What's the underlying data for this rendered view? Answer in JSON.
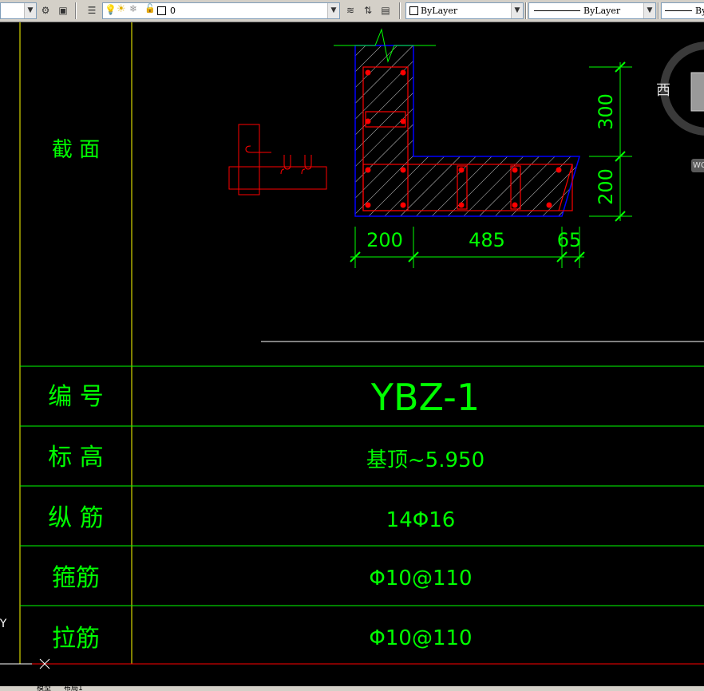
{
  "toolbar": {
    "layer_name": "0",
    "color_value": "ByLayer",
    "linetype_value": "ByLayer",
    "lineweight_value": "By"
  },
  "viewcube": {
    "compass_label": "西",
    "wcs_label": "WC"
  },
  "table": {
    "rows": [
      {
        "label": "截 面"
      },
      {
        "label": "编 号",
        "value": "YBZ-1"
      },
      {
        "label": "标 高",
        "value": "基顶~5.950"
      },
      {
        "label": "纵 筋",
        "value": "14Φ16"
      },
      {
        "label": "箍筋",
        "value": "Φ10@110"
      },
      {
        "label": "拉筋",
        "value": "Φ10@110"
      }
    ]
  },
  "section": {
    "dim_vertical": [
      "300",
      "200"
    ],
    "dim_horizontal": [
      "200",
      "485",
      "65"
    ]
  },
  "ucs": {
    "y_label": "Y"
  },
  "tabs": [
    "模型",
    "布局1"
  ],
  "colors": {
    "green": "#00ff00",
    "red": "#ff0000",
    "blue": "#0000ff",
    "background": "#000000"
  }
}
